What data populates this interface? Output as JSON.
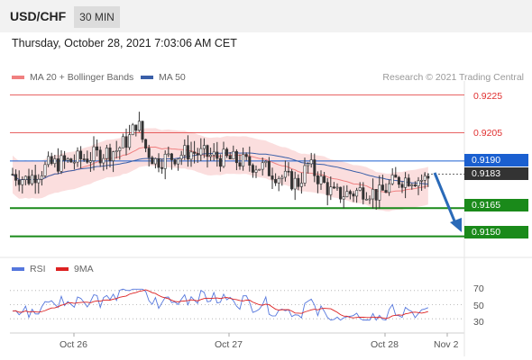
{
  "header": {
    "symbol": "USD/CHF",
    "interval": "30 MIN",
    "datetime": "Thursday, October 28, 2021 7:03:06 AM CET"
  },
  "legend": {
    "ma20_label": "MA 20 + Bollinger Bands",
    "ma50_label": "MA 50",
    "ma20_color": "#f08080",
    "ma50_color": "#3a5fa8",
    "credit": "Research © 2021 Trading Central"
  },
  "rsi_legend": {
    "rsi_label": "RSI",
    "ma9_label": "9MA",
    "rsi_color": "#5577dd",
    "ma9_color": "#dd2222"
  },
  "chart_data": {
    "type": "candlestick",
    "price_levels": {
      "resistance_2": "0.9225",
      "resistance_1": "0.9205",
      "pivot": "0.9190",
      "last_price": "0.9183",
      "support_1": "0.9165",
      "support_2": "0.9150"
    },
    "x_tick_labels": [
      "Oct 26",
      "Oct 27",
      "Oct 28",
      "Nov 2"
    ],
    "rsi_ticks": [
      "70",
      "50",
      "30"
    ],
    "price_range": [
      0.9146,
      0.9232
    ],
    "rsi_range": [
      20,
      80
    ]
  },
  "colors": {
    "resistance": "#e03030",
    "support": "#1a8a1a",
    "pivot": "#1a5fd0",
    "last": "#333333",
    "candle": "#333333",
    "bb_fill": "#fbdada",
    "arrow": "#2a6ab8"
  }
}
